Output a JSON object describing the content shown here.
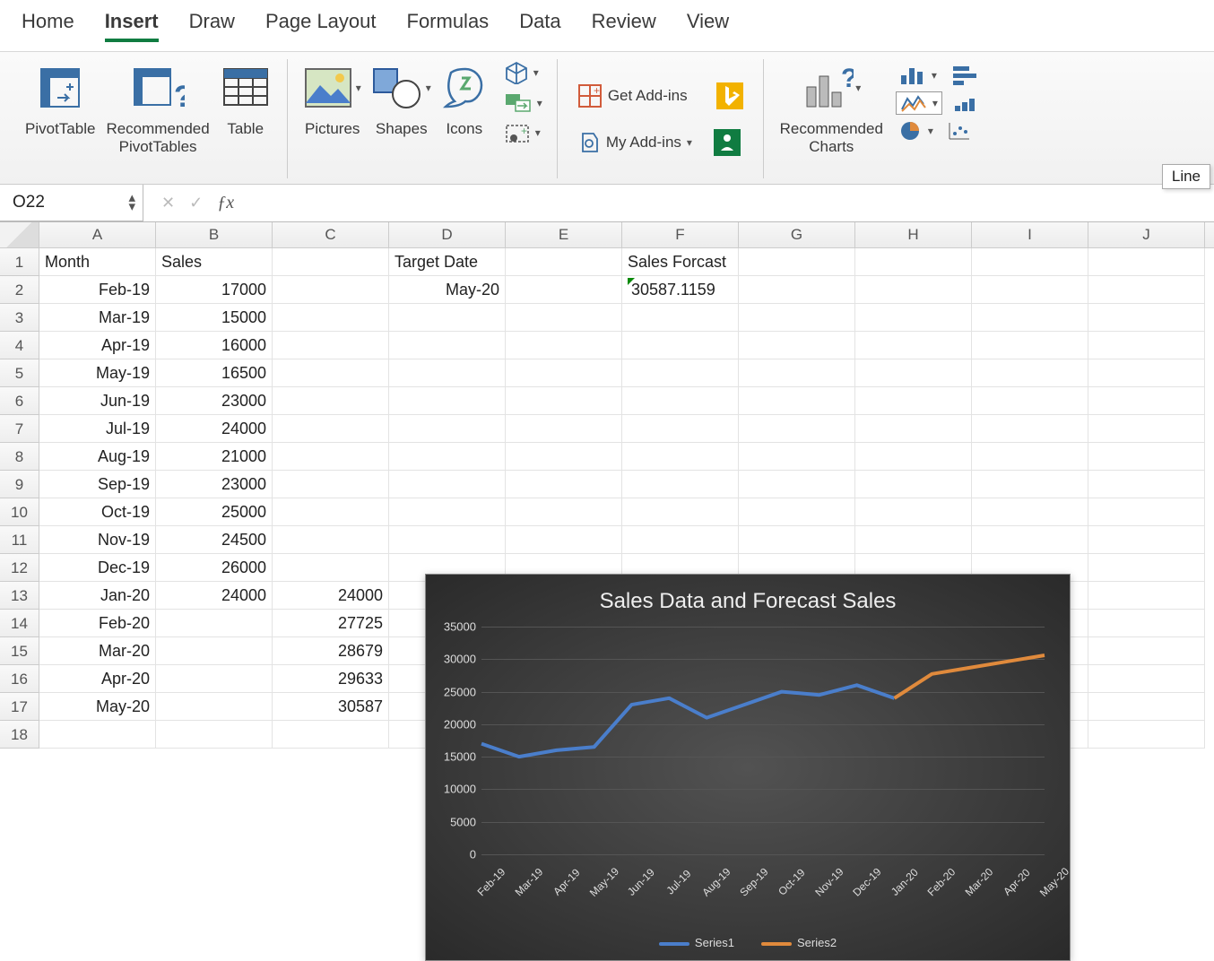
{
  "ribbon": {
    "tabs": [
      "Home",
      "Insert",
      "Draw",
      "Page Layout",
      "Formulas",
      "Data",
      "Review",
      "View"
    ],
    "active": 1,
    "buttons": {
      "pivottable": "PivotTable",
      "recommended_pivot": "Recommended\nPivotTables",
      "table": "Table",
      "pictures": "Pictures",
      "shapes": "Shapes",
      "icons": "Icons",
      "get_addins": "Get Add-ins",
      "my_addins": "My Add-ins",
      "recommended_charts": "Recommended\nCharts",
      "tooltip_line": "Line"
    }
  },
  "formula_bar": {
    "name_box": "O22",
    "formula": ""
  },
  "columns": [
    "A",
    "B",
    "C",
    "D",
    "E",
    "F",
    "G",
    "H",
    "I",
    "J"
  ],
  "cells": {
    "A1": "Month",
    "B1": "Sales",
    "D1": "Target Date",
    "F1": "Sales Forcast",
    "A2": "Feb-19",
    "B2": "17000",
    "D2": "May-20",
    "F2": "30587.1159",
    "A3": "Mar-19",
    "B3": "15000",
    "A4": "Apr-19",
    "B4": "16000",
    "A5": "May-19",
    "B5": "16500",
    "A6": "Jun-19",
    "B6": "23000",
    "A7": "Jul-19",
    "B7": "24000",
    "A8": "Aug-19",
    "B8": "21000",
    "A9": "Sep-19",
    "B9": "23000",
    "A10": "Oct-19",
    "B10": "25000",
    "A11": "Nov-19",
    "B11": "24500",
    "A12": "Dec-19",
    "B12": "26000",
    "A13": "Jan-20",
    "B13": "24000",
    "C13": "24000",
    "A14": "Feb-20",
    "C14": "27725",
    "A15": "Mar-20",
    "C15": "28679",
    "A16": "Apr-20",
    "C16": "29633",
    "A17": "May-20",
    "C17": "30587"
  },
  "chart_data": {
    "type": "line",
    "title": "Sales Data and Forecast Sales",
    "xlabel": "",
    "ylabel": "",
    "ylim": [
      0,
      35000
    ],
    "yticks": [
      0,
      5000,
      10000,
      15000,
      20000,
      25000,
      30000,
      35000
    ],
    "categories": [
      "Feb-19",
      "Mar-19",
      "Apr-19",
      "May-19",
      "Jun-19",
      "Jul-19",
      "Aug-19",
      "Sep-19",
      "Oct-19",
      "Nov-19",
      "Dec-19",
      "Jan-20",
      "Feb-20",
      "Mar-20",
      "Apr-20",
      "May-20"
    ],
    "series": [
      {
        "name": "Series1",
        "color": "#4a7ecb",
        "values": [
          17000,
          15000,
          16000,
          16500,
          23000,
          24000,
          21000,
          23000,
          25000,
          24500,
          26000,
          24000,
          null,
          null,
          null,
          null
        ]
      },
      {
        "name": "Series2",
        "color": "#e08a3c",
        "values": [
          null,
          null,
          null,
          null,
          null,
          null,
          null,
          null,
          null,
          null,
          null,
          24000,
          27725,
          28679,
          29633,
          30587
        ]
      }
    ]
  }
}
